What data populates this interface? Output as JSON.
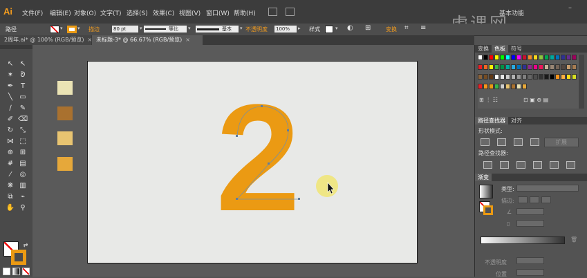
{
  "app": {
    "logo": "Ai",
    "workspace": "基本功能",
    "watermark": "虎课网"
  },
  "menu": [
    "文件(F)",
    "编辑(E)",
    "对象(O)",
    "文字(T)",
    "选择(S)",
    "效果(C)",
    "视图(V)",
    "窗口(W)",
    "帮助(H)"
  ],
  "control_bar": {
    "object_type": "路径",
    "stroke_label": "描边",
    "stroke_weight": "80 pt",
    "stroke_profile": "等比",
    "brush": "基本",
    "opacity_label": "不透明度",
    "opacity": "100%",
    "style_label": "样式",
    "transform_label": "变换"
  },
  "tabs": [
    {
      "label": "2周年.ai* @ 100% (RGB/预览)",
      "close": "×"
    },
    {
      "label": "未标题-3* @ 66.67% (RGB/预览)",
      "close": "×"
    }
  ],
  "canvas": {
    "glyph": "2",
    "glyph_color": "#eb9a13",
    "palette_swatches": [
      "#eae3b4",
      "#a9712f",
      "#e8c471",
      "#e6a83a"
    ]
  },
  "colors": {
    "accent": "#f39c1e",
    "artboard": "#e8e9e7",
    "cursor_highlight": "#efe67a"
  },
  "swatches_panel": {
    "tabs": [
      "变换",
      "色板",
      "符号"
    ],
    "active": "色板",
    "rows": [
      [
        "#ffffff",
        "#000000",
        "#ff0000",
        "#ffff00",
        "#00ff00",
        "#00ffff",
        "#0000ff",
        "#ff00ff",
        "#c8102e",
        "#f28c28",
        "#f9d71c",
        "#8dc63f",
        "#00a651",
        "#00a99d",
        "#0072bc",
        "#2e3192",
        "#662d91",
        "#9e005d"
      ],
      [
        "#ed1c24",
        "#f26522",
        "#fff200",
        "#39b54a",
        "#009245",
        "#00a99d",
        "#29abe2",
        "#0071bc",
        "#2e3192",
        "#92278f",
        "#ec008c",
        "#ed145b",
        "#c7b299",
        "#998675",
        "#736357",
        "#534741",
        "#c69c6d",
        "#a67c52"
      ],
      [
        "#8c6239",
        "#754c24",
        "#603813",
        "#ffffff",
        "#e6e6e6",
        "#cccccc",
        "#b3b3b3",
        "#999999",
        "#808080",
        "#666666",
        "#4d4d4d",
        "#333333",
        "#1a1a1a",
        "#000000",
        "#f7941d",
        "#fbb040",
        "#ffde17",
        "#d7df23"
      ],
      [
        "#ed1c24",
        "#f7941d",
        "#eb9a13",
        "#39b54a",
        "#cfcfcf",
        "#e8c471",
        "#a9712f",
        "#eae3b4",
        "#e6a83a"
      ]
    ]
  },
  "pathfinder_panel": {
    "tabs": [
      "路径查找器",
      "对齐"
    ],
    "shape_modes_label": "形状模式:",
    "expand_button": "扩展",
    "pathfinders_label": "路径查找器:"
  },
  "gradient_panel": {
    "tab": "渐变",
    "type_label": "类型:",
    "stroke_label": "描边:",
    "opacity_label": "不透明度",
    "location_label": "位置"
  }
}
